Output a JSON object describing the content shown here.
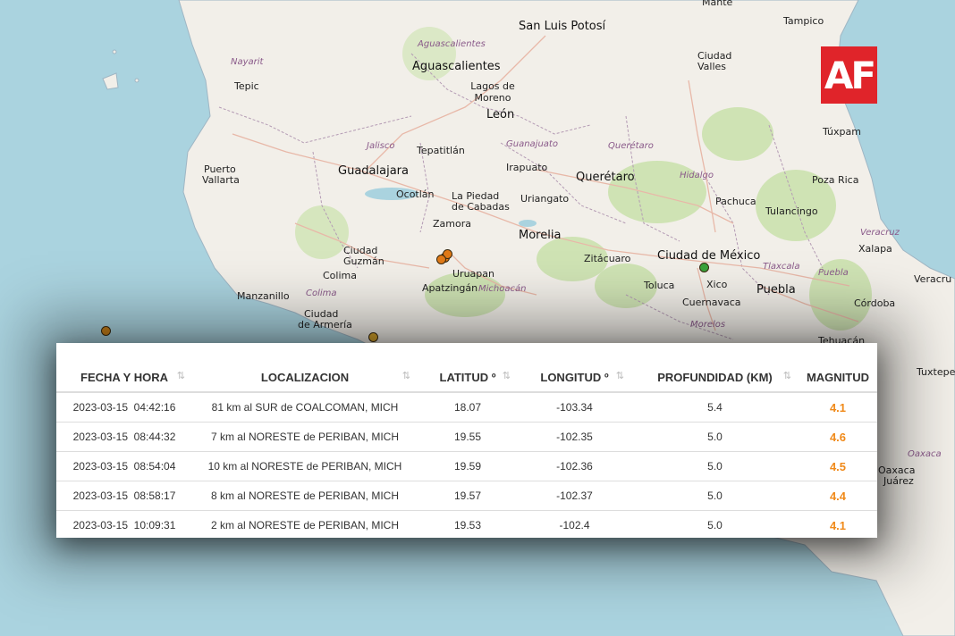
{
  "logo": "AF",
  "map": {
    "labels": [
      {
        "text": "San Luis Potosí",
        "cls": "bigcity"
      },
      {
        "text": "Aguascalientes",
        "cls": "state"
      },
      {
        "text": "Aguascalientes",
        "cls": "bigcity"
      },
      {
        "text": "Lagos de Moreno",
        "cls": "city"
      },
      {
        "text": "León",
        "cls": "bigcity"
      },
      {
        "text": "Nayarit",
        "cls": "state"
      },
      {
        "text": "Tepic",
        "cls": "city"
      },
      {
        "text": "Jalisco",
        "cls": "state"
      },
      {
        "text": "Tepatitlán",
        "cls": "city"
      },
      {
        "text": "Guanajuato",
        "cls": "state"
      },
      {
        "text": "Querétaro",
        "cls": "state"
      },
      {
        "text": "Guadalajara",
        "cls": "bigcity"
      },
      {
        "text": "Irapuato",
        "cls": "city"
      },
      {
        "text": "Querétaro",
        "cls": "bigcity"
      },
      {
        "text": "Puerto",
        "cls": "city"
      },
      {
        "text": "Vallarta",
        "cls": "city"
      },
      {
        "text": "Ocotlán",
        "cls": "city"
      },
      {
        "text": "La Piedad",
        "cls": "city"
      },
      {
        "text": "de Cabadas",
        "cls": "city"
      },
      {
        "text": "Uriangato",
        "cls": "city"
      },
      {
        "text": "Hidalgo",
        "cls": "state"
      },
      {
        "text": "Pachuca",
        "cls": "city"
      },
      {
        "text": "Poza Rica",
        "cls": "city"
      },
      {
        "text": "Tulancingo",
        "cls": "city"
      },
      {
        "text": "Zamora",
        "cls": "city"
      },
      {
        "text": "Morelia",
        "cls": "bigcity"
      },
      {
        "text": "Veracruz",
        "cls": "state"
      },
      {
        "text": "Xalapa",
        "cls": "city"
      },
      {
        "text": "Ciudad",
        "cls": "city"
      },
      {
        "text": "Guzmán",
        "cls": "city"
      },
      {
        "text": "Zitácuaro",
        "cls": "city"
      },
      {
        "text": "Ciudad de México",
        "cls": "bigcity"
      },
      {
        "text": "Tlaxcala",
        "cls": "state"
      },
      {
        "text": "Colima",
        "cls": "city"
      },
      {
        "text": "Uruapan",
        "cls": "city"
      },
      {
        "text": "Puebla",
        "cls": "state"
      },
      {
        "text": "Veracru",
        "cls": "city"
      },
      {
        "text": "Apatzingán",
        "cls": "city"
      },
      {
        "text": "Michoacán",
        "cls": "state"
      },
      {
        "text": "Toluca",
        "cls": "city"
      },
      {
        "text": "Xico",
        "cls": "city"
      },
      {
        "text": "Puebla",
        "cls": "bigcity"
      },
      {
        "text": "Manzanillo",
        "cls": "city"
      },
      {
        "text": "Colima",
        "cls": "state"
      },
      {
        "text": "Cuernavaca",
        "cls": "city"
      },
      {
        "text": "Ciudad",
        "cls": "city"
      },
      {
        "text": "de Armería",
        "cls": "city"
      },
      {
        "text": "Morelos",
        "cls": "state"
      },
      {
        "text": "Córdoba",
        "cls": "city"
      },
      {
        "text": "Tehuacán",
        "cls": "city"
      },
      {
        "text": "Tuxtepec",
        "cls": "city"
      },
      {
        "text": "Oaxaca",
        "cls": "state"
      },
      {
        "text": "Oaxaca",
        "cls": "city"
      },
      {
        "text": "Juárez",
        "cls": "city"
      },
      {
        "text": "Ciudad",
        "cls": "city"
      },
      {
        "text": "Valles",
        "cls": "city"
      },
      {
        "text": "Tampico",
        "cls": "city"
      },
      {
        "text": "Túxpam",
        "cls": "city"
      },
      {
        "text": "Mante",
        "cls": "city"
      }
    ]
  },
  "table": {
    "headers": [
      "FECHA Y HORA",
      "LOCALIZACION",
      "LATITUD º",
      "LONGITUD º",
      "PROFUNDIDAD (KM)",
      "MAGNITUD"
    ],
    "rows": [
      {
        "fecha": "2023-03-15  04:42:16",
        "loc": "81 km al SUR de COALCOMAN, MICH",
        "lat": "18.07",
        "lon": "-103.34",
        "prof": "5.4",
        "mag": "4.1"
      },
      {
        "fecha": "2023-03-15  08:44:32",
        "loc": "7 km al NORESTE de PERIBAN, MICH",
        "lat": "19.55",
        "lon": "-102.35",
        "prof": "5.0",
        "mag": "4.6"
      },
      {
        "fecha": "2023-03-15  08:54:04",
        "loc": "10 km al NORESTE de PERIBAN, MICH",
        "lat": "19.59",
        "lon": "-102.36",
        "prof": "5.0",
        "mag": "4.5"
      },
      {
        "fecha": "2023-03-15  08:58:17",
        "loc": "8 km al NORESTE de PERIBAN, MICH",
        "lat": "19.57",
        "lon": "-102.37",
        "prof": "5.0",
        "mag": "4.4"
      },
      {
        "fecha": "2023-03-15  10:09:31",
        "loc": "2 km al NORESTE de PERIBAN, MICH",
        "lat": "19.53",
        "lon": "-102.4",
        "prof": "5.0",
        "mag": "4.1"
      }
    ]
  },
  "colors": {
    "magnitude": "#f08a1a",
    "quake_orange": "#e07a18",
    "quake_yellow": "#d9a62c",
    "quake_green": "#3aa23a",
    "logo_bg": "#e0242a"
  }
}
